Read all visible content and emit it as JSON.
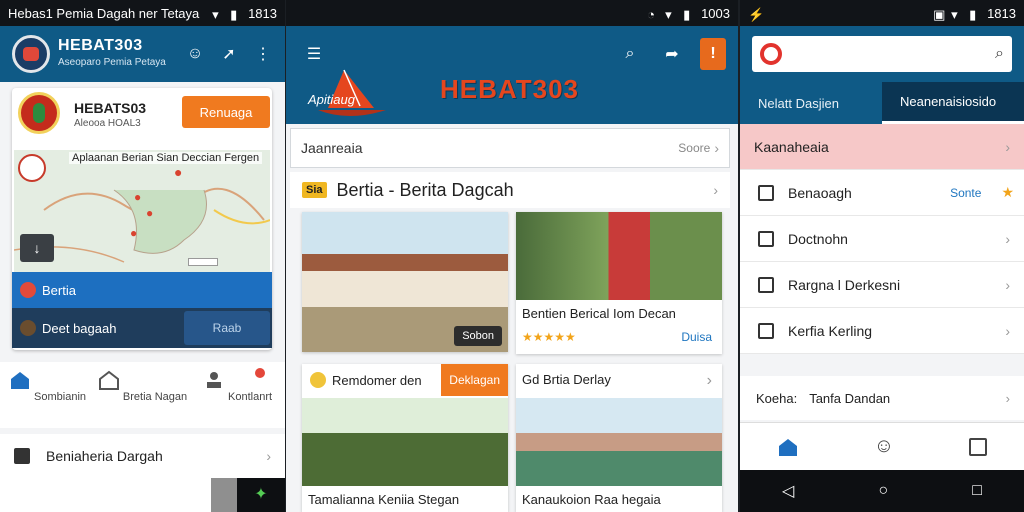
{
  "statusbar": {
    "left_title": "Hebas1 Pemia Dagah ner Tetaya",
    "left_time": "1813",
    "middle_time": "1003",
    "right_time": "1813"
  },
  "panel1": {
    "brand": "HEBAT303",
    "brand_sub": "Aseoparo Pemia Petaya",
    "profile_name": "HEBATS03",
    "profile_sub": "Aleooa HOAL3",
    "register_label": "Renuaga",
    "map_title": "Aplaanan Berian Sian Deccian Fergen",
    "berita_label": "Bertia",
    "dagang_label": "Deet bagaah",
    "dagang_btn": "Raab",
    "nav": [
      {
        "label": "Sombianin",
        "icon": "home-icon"
      },
      {
        "label": "Bretia Nagan",
        "icon": "store-icon"
      },
      {
        "label": "Kontlanrt",
        "icon": "user-icon"
      }
    ],
    "list_row": "Beniaheria Dargah"
  },
  "panel2": {
    "boat_text": "Apitiaug",
    "hero": "HEBAT303",
    "search_text": "Jaanreaia",
    "search_meta": "Soore",
    "section_tag": "Sia",
    "section_title": "Bertia - Berita Dagcah",
    "n1_button": "Sobon",
    "n2_caption": "Bentien Berical Iom Decan",
    "n2_link": "Duisa",
    "n3_head": "Remdomer den",
    "n3_orange": "Deklagan",
    "n3_caption": "Tamalianna Keniia Stegan",
    "n4_head": "Gd Brtia Derlay",
    "n4_caption": "Kanaukoion Raa hegaia"
  },
  "panel3": {
    "tabs": [
      "Nelatt Dasjien",
      "Neanenaisiosido"
    ],
    "rows": [
      {
        "label": "Kaanaheaia",
        "highlight": true
      },
      {
        "label": "Benaoagh",
        "link": "Sonte",
        "star": "★"
      },
      {
        "label": "Doctnohn"
      },
      {
        "label": "Rargna l Derkesni"
      },
      {
        "label": "Kerfia Kerling"
      }
    ],
    "footer_key": "Koeha:",
    "footer_value": "Tanfa Dandan"
  },
  "colors": {
    "primary": "#0f5a86",
    "accent": "#f07a1f",
    "hero": "#e5461e"
  }
}
